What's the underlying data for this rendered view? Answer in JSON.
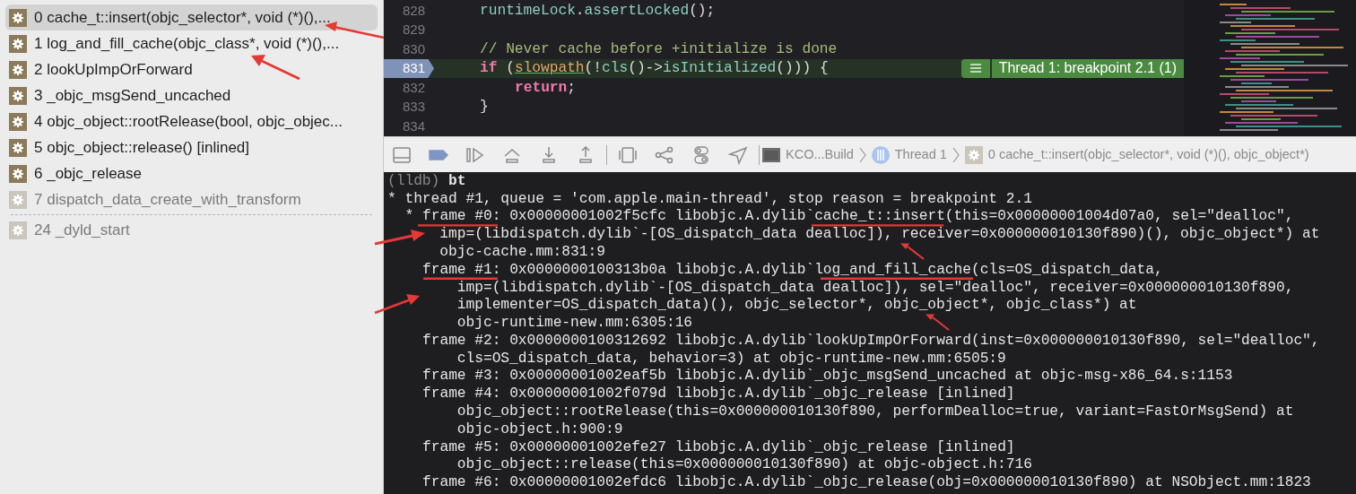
{
  "stack_frames": [
    {
      "kind": "frame",
      "label": "0 cache_t::insert(objc_selector*, void (*)(),...",
      "selected": true,
      "dimmed": false
    },
    {
      "kind": "frame",
      "label": "1 log_and_fill_cache(objc_class*, void (*)(),...",
      "selected": false,
      "dimmed": false
    },
    {
      "kind": "frame",
      "label": "2 lookUpImpOrForward",
      "selected": false,
      "dimmed": false
    },
    {
      "kind": "frame",
      "label": "3 _objc_msgSend_uncached",
      "selected": false,
      "dimmed": false
    },
    {
      "kind": "frame",
      "label": "4 objc_object::rootRelease(bool, objc_objec...",
      "selected": false,
      "dimmed": false
    },
    {
      "kind": "frame",
      "label": "5 objc_object::release() [inlined]",
      "selected": false,
      "dimmed": false
    },
    {
      "kind": "frame",
      "label": "6 _objc_release",
      "selected": false,
      "dimmed": false
    },
    {
      "kind": "frame",
      "label": "7 dispatch_data_create_with_transform",
      "selected": false,
      "dimmed": true
    },
    {
      "kind": "separator"
    },
    {
      "kind": "frame",
      "label": "24 _dyld_start",
      "selected": false,
      "dimmed": true
    }
  ],
  "editor": {
    "lines": [
      {
        "number": "828",
        "current": false,
        "indented": false,
        "tokens": [
          {
            "t": "runtimeLock",
            "kind": "call"
          },
          {
            "t": ".",
            "kind": "plain"
          },
          {
            "t": "assertLocked",
            "kind": "call"
          },
          {
            "t": "();",
            "kind": "plain"
          }
        ]
      },
      {
        "number": "829",
        "current": false
      },
      {
        "number": "830",
        "current": false,
        "indented": false,
        "tokens": [
          {
            "t": "// Never cache before +initialize is done",
            "kind": "comment"
          }
        ]
      },
      {
        "number": "831",
        "current": true,
        "indented": false,
        "badge": "Thread 1: breakpoint 2.1 (1)",
        "tokens": [
          {
            "t": "if",
            "kind": "keyword"
          },
          {
            "t": " (",
            "kind": "plain"
          },
          {
            "t": "slowpath",
            "kind": "macro"
          },
          {
            "t": "(!",
            "kind": "plain"
          },
          {
            "t": "cls",
            "kind": "call"
          },
          {
            "t": "()->",
            "kind": "plain"
          },
          {
            "t": "isInitialized",
            "kind": "call"
          },
          {
            "t": "())) {",
            "kind": "plain"
          }
        ]
      },
      {
        "number": "832",
        "current": false,
        "indented": true,
        "tokens": [
          {
            "t": "return",
            "kind": "keyword"
          },
          {
            "t": ";",
            "kind": "plain"
          }
        ]
      },
      {
        "number": "833",
        "current": false,
        "indented": false,
        "tokens": [
          {
            "t": "}",
            "kind": "plain"
          }
        ]
      },
      {
        "number": "834",
        "current": false
      }
    ]
  },
  "debug_bar": {
    "breakpoints_active": true,
    "breadcrumbs": [
      {
        "kind": "target",
        "label": "KCO...Build"
      },
      {
        "kind": "thread",
        "label": "Thread 1"
      },
      {
        "kind": "frame",
        "label": "0 cache_t::insert(objc_selector*, void (*)(), objc_object*)"
      }
    ]
  },
  "console": {
    "prompt": "(lldb)",
    "command": "bt",
    "thread": "* thread #1, queue = 'com.apple.main-thread', stop reason = breakpoint 2.1",
    "frames": [
      {
        "marker": "*",
        "text": "frame #0: 0x00000001002f5cfc libobjc.A.dylib`cache_t::insert(this=0x00000001004d07a0, sel=\"dealloc\",",
        "details": [
          "imp=(libdispatch.dylib`-[OS_dispatch_data dealloc]), receiver=0x000000010130f890)(), objc_object*) at",
          "objc-cache.mm:831:9"
        ]
      },
      {
        "text": "frame #1: 0x0000000100313b0a libobjc.A.dylib`log_and_fill_cache(cls=OS_dispatch_data,",
        "details": [
          "imp=(libdispatch.dylib`-[OS_dispatch_data dealloc]), sel=\"dealloc\", receiver=0x000000010130f890,",
          "implementer=OS_dispatch_data)(), objc_selector*, objc_object*, objc_class*) at",
          "objc-runtime-new.mm:6305:16"
        ]
      },
      {
        "text": "frame #2: 0x0000000100312692 libobjc.A.dylib`lookUpImpOrForward(inst=0x000000010130f890, sel=\"dealloc\",",
        "details": [
          "cls=OS_dispatch_data, behavior=3) at objc-runtime-new.mm:6505:9"
        ]
      },
      {
        "text": "frame #3: 0x00000001002eaf5b libobjc.A.dylib`_objc_msgSend_uncached at objc-msg-x86_64.s:1153"
      },
      {
        "text": "frame #4: 0x00000001002f079d libobjc.A.dylib`_objc_release [inlined]",
        "details": [
          "objc_object::rootRelease(this=0x000000010130f890, performDealloc=true, variant=FastOrMsgSend) at",
          "objc-object.h:900:9"
        ]
      },
      {
        "text": "frame #5: 0x00000001002efe27 libobjc.A.dylib`_objc_release [inlined]",
        "details": [
          "objc_object::release(this=0x000000010130f890) at objc-object.h:716"
        ]
      },
      {
        "text": "frame #6: 0x00000001002efdc6 libobjc.A.dylib`_objc_release(obj=0x000000010130f890) at NSObject.mm:1823"
      }
    ]
  }
}
